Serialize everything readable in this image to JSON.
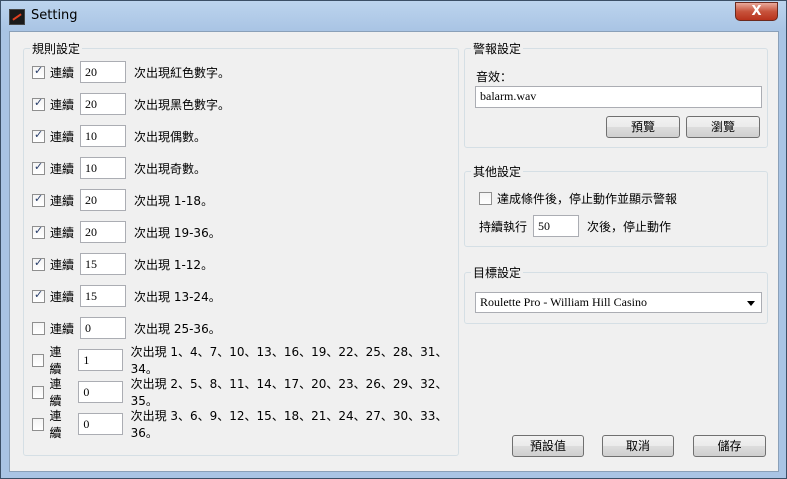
{
  "window": {
    "title": "Setting",
    "close_glyph": "X"
  },
  "rules": {
    "title": "規則設定",
    "label_prefix": "連續",
    "items": [
      {
        "checked": true,
        "value": "20",
        "text": "次出現紅色數字。"
      },
      {
        "checked": true,
        "value": "20",
        "text": "次出現黑色數字。"
      },
      {
        "checked": true,
        "value": "10",
        "text": "次出現偶數。"
      },
      {
        "checked": true,
        "value": "10",
        "text": "次出現奇數。"
      },
      {
        "checked": true,
        "value": "20",
        "text": "次出現 1-18。"
      },
      {
        "checked": true,
        "value": "20",
        "text": "次出現 19-36。"
      },
      {
        "checked": true,
        "value": "15",
        "text": "次出現 1-12。"
      },
      {
        "checked": true,
        "value": "15",
        "text": "次出現 13-24。"
      },
      {
        "checked": false,
        "value": "0",
        "text": "次出現 25-36。"
      },
      {
        "checked": false,
        "value": "1",
        "text": "次出現 1、4、7、10、13、16、19、22、25、28、31、34。"
      },
      {
        "checked": false,
        "value": "0",
        "text": "次出現 2、5、8、11、14、17、20、23、26、29、32、35。"
      },
      {
        "checked": false,
        "value": "0",
        "text": "次出現 3、6、9、12、15、18、21、24、27、30、33、36。"
      }
    ]
  },
  "alarm": {
    "title": "警報設定",
    "sound_label": "音效：",
    "sound_value": "balarm.wav",
    "preview_label": "預覽",
    "browse_label": "瀏覽"
  },
  "other": {
    "title": "其他設定",
    "stop_checkbox_label": "達成條件後，停止動作並顯示警報",
    "stop_checked": false,
    "continue_label": "持續執行",
    "continue_value": "50",
    "continue_suffix": "次後，停止動作"
  },
  "target": {
    "title": "目標設定",
    "selected": "Roulette Pro - William Hill Casino"
  },
  "footer": {
    "default_label": "預設值",
    "cancel_label": "取消",
    "save_label": "儲存"
  }
}
